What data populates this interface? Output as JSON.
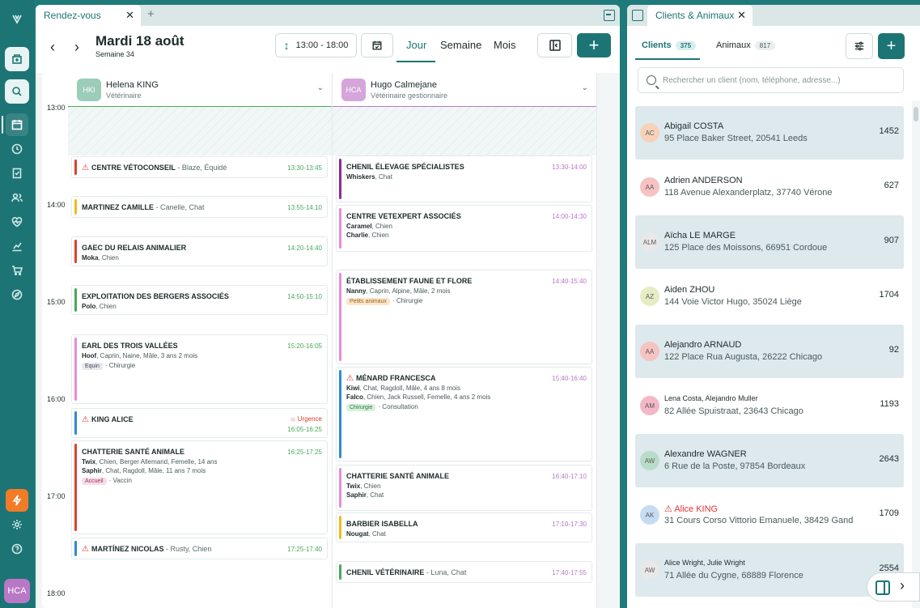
{
  "sidebar": {
    "avatar_initials": "HCA"
  },
  "main": {
    "tab_label": "Rendez-vous",
    "date_title": "Mardi 18 août",
    "week_label": "Semaine 34",
    "time_range": "13:00 - 18:00",
    "views": {
      "day": "Jour",
      "week": "Semaine",
      "month": "Mois"
    }
  },
  "calendar": {
    "hours": [
      "13:00",
      "14:00",
      "15:00",
      "16:00",
      "17:00",
      "18:00"
    ],
    "vets": [
      {
        "initials": "HKI",
        "name": "Helena KING",
        "role": "Vétérinaire",
        "color": "#9ccdb9"
      },
      {
        "initials": "HCA",
        "name": "Hugo Calmejane",
        "role": "Vétérinaire gestionnaire",
        "color": "#d6a5dc"
      }
    ],
    "col1": [
      {
        "title": "CENTRE VÉTOCONSEIL",
        "sub": " - Blaze, Équidé",
        "time": "13:30-13:45",
        "color": "#d9432f",
        "warn": true
      },
      {
        "title": "MARTINEZ CAMILLE",
        "sub": " - Canelle, Chat",
        "time": "13:55-14:10",
        "color": "#f0bb1e"
      },
      {
        "title": "GAEC DU RELAIS ANIMALIER",
        "time": "14:20-14:40",
        "color": "#d9432f",
        "l1b": "Moka",
        "l1": ", Chien"
      },
      {
        "title": "EXPLOITATION DES BERGERS ASSOCIÉS",
        "time": "14:50-15:10",
        "color": "#4aa85a",
        "l1b": "Polo",
        "l1": ", Chien"
      },
      {
        "title": "EARL DES TROIS VALLÉES",
        "time": "15:20-16:05",
        "color": "#e68bd9",
        "l1b": "Hoof",
        "l1": ", Caprin, Naine, Mâle, 3 ans 2 mois",
        "tag": "Equin",
        "tag2": "Chirurgie"
      },
      {
        "title": "KING ALICE",
        "time": "16:05-16:25",
        "urgence": "Urgence",
        "color": "#2f8bd3",
        "warn": true
      },
      {
        "title": "CHATTERIE SANTÉ ANIMALE",
        "time": "16:25-17:25",
        "color": "#d9432f",
        "l1b": "Twix",
        "l1": ", Chien, Berger Allemand, Femelle, 14 ans",
        "l2b": "Saphir",
        "l2": ", Chat, Ragdoll, Mâle, 11 ans 7 mois",
        "tag": "Accueil",
        "tag2": "Vaccin"
      },
      {
        "title": "MARTÍNEZ NICOLAS",
        "sub": " - Rusty, Chien",
        "time": "17:25-17:40",
        "color": "#2f8bd3",
        "warn": true
      }
    ],
    "col2": [
      {
        "title": "CHENIL ÉLEVAGE SPÉCIALISTES",
        "time": "13:30-14:00",
        "color": "#8e2a96",
        "l1b": "Whiskers",
        "l1": ", Chat"
      },
      {
        "title": "CENTRE VETEXPERT ASSOCIÉS",
        "time": "14:00-14:30",
        "color": "#e68bd9",
        "l1b": "Caramel",
        "l1": ", Chien",
        "l2b": "Charlie",
        "l2": ", Chien"
      },
      {
        "title": "ÉTABLISSEMENT FAUNE ET FLORE",
        "time": "14:40-15:40",
        "color": "#e68bd9",
        "l1b": "Nanny",
        "l1": ", Caprin, Alpine, Mâle, 2 mois",
        "tag": "Petits animaux",
        "tag2": "Chirurgie"
      },
      {
        "title": "MÉNARD FRANCESCA",
        "time": "15:40-16:40",
        "color": "#2f8bd3",
        "warn": true,
        "l1b": "Kiwi",
        "l1": ", Chat, Ragdoll, Mâle, 4 ans 8 mois",
        "l2b": "Falco",
        "l2": ", Chien, Jack Russell, Femelle, 4 ans 2 mois",
        "tag": "Chirurgie",
        "tag2": "Consultation"
      },
      {
        "title": "CHATTERIE SANTÉ ANIMALE",
        "time": "16:40-17:10",
        "color": "#e68bd9",
        "l1b": "Twix",
        "l1": ", Chien",
        "l2b": "Saphir",
        "l2": ", Chat"
      },
      {
        "title": "BARBIER ISABELLA",
        "time": "17:10-17:30",
        "color": "#f0bb1e",
        "l1b": "Nougat",
        "l1": ", Chat"
      },
      {
        "title": "CHENIL VÉTÉRINAIRE",
        "sub": " - Luna, Chat",
        "time": "17:40-17:55",
        "color": "#4aa85a"
      }
    ]
  },
  "right": {
    "tab_label": "Clients & Animaux",
    "seg_clients": "Clients",
    "seg_clients_count": "375",
    "seg_animals": "Animaux",
    "seg_animals_count": "817",
    "search_placeholder": "Rechercher un client (nom, téléphone, adresse...)",
    "clients": [
      {
        "initials": "AC",
        "name": "Abigail COSTA",
        "address": "95 Place Baker Street, 20541 Leeds",
        "number": "1452",
        "av": "#f6d3b8"
      },
      {
        "initials": "AA",
        "name": "Adrien ANDERSON",
        "address": "118 Avenue Alexanderplatz, 37740 Vérone",
        "number": "627",
        "av": "#f6c2c2"
      },
      {
        "initials": "ALM",
        "name": "Aïcha LE MARGE",
        "address": "125 Place des Moissons, 66951 Cordoue",
        "number": "907",
        "av": "#e8e8e8"
      },
      {
        "initials": "AZ",
        "name": "Aiden ZHOU",
        "address": "144 Voie Victor Hugo, 35024 Liège",
        "number": "1704",
        "av": "#e6ecc4"
      },
      {
        "initials": "AA",
        "name": "Alejandro ARNAUD",
        "address": "122 Place Rua Augusta, 26222 Chicago",
        "number": "92",
        "av": "#f6c2c2"
      },
      {
        "initials": "AM",
        "name": "Lena Costa, Alejandro Muller",
        "address": "82 Allée Spuistraat, 23643 Chicago",
        "number": "1193",
        "av": "#f3b7c5"
      },
      {
        "initials": "AW",
        "name": "Alexandre WAGNER",
        "address": "6 Rue de la Poste, 97854 Bordeaux",
        "number": "2643",
        "av": "#b8dcc8"
      },
      {
        "initials": "AK",
        "name": "Alice KING",
        "address": "31 Cours Corso Vittorio Emanuele, 38429 Gand",
        "number": "1709",
        "av": "#c6dcf3"
      },
      {
        "initials": "AW",
        "name": "Alice Wright, Julie Wright",
        "address": "71 Allée du Cygne, 68889 Florence",
        "number": "2554",
        "av": "#e8e8e8"
      }
    ]
  }
}
